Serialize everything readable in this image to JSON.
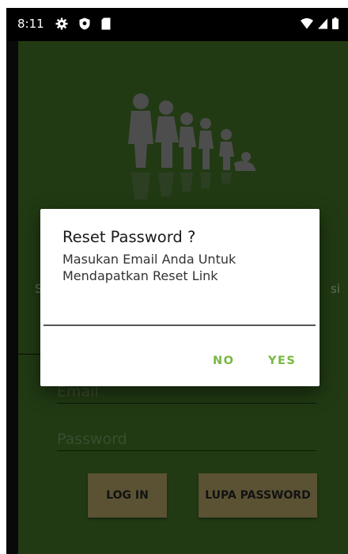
{
  "status_bar": {
    "time": "8:11",
    "icons_left": [
      "gear-icon",
      "shield-icon",
      "sd-card-icon"
    ],
    "icons_right": [
      "wifi-icon",
      "signal-icon",
      "battery-icon"
    ]
  },
  "login": {
    "email_placeholder": "Email",
    "password_placeholder": "Password",
    "login_button": "LOG IN",
    "forgot_button": "LUPA PASSWORD",
    "side_left_text": "S",
    "side_right_text": "si"
  },
  "dialog": {
    "title": "Reset Password ?",
    "message": "Masukan Email Anda Untuk Mendapatkan Reset Link",
    "input_value": "",
    "no_label": "NO",
    "yes_label": "YES",
    "accent_color": "#78b843"
  },
  "colors": {
    "background": "#3c6a23",
    "button": "#a5955d"
  }
}
